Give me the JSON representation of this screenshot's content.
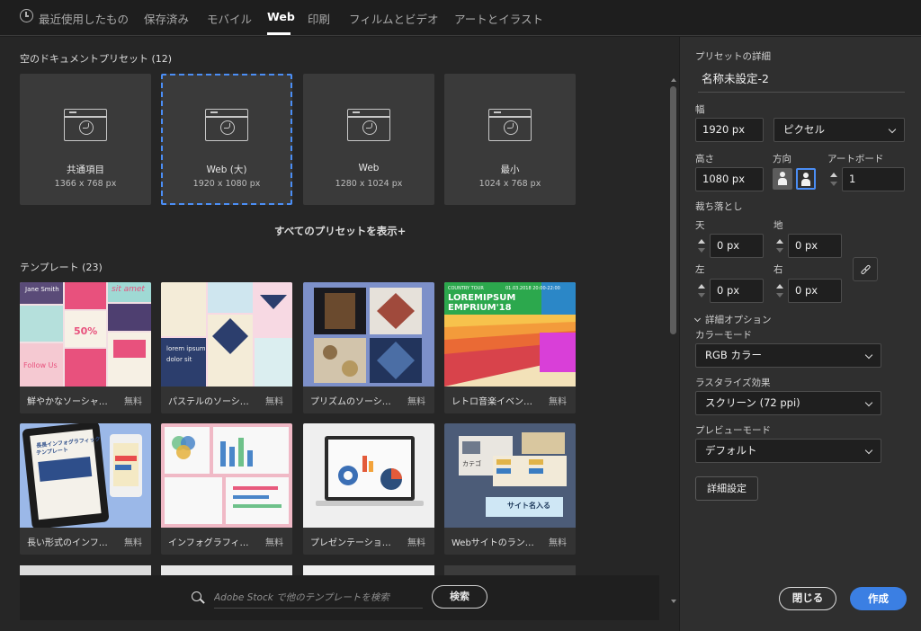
{
  "tabs": [
    {
      "label": "最近使用したもの"
    },
    {
      "label": "保存済み"
    },
    {
      "label": "モバイル"
    },
    {
      "label": "Web"
    },
    {
      "label": "印刷"
    },
    {
      "label": "フィルムとビデオ"
    },
    {
      "label": "アートとイラスト"
    }
  ],
  "active_tab": "Web",
  "presets_section": {
    "title": "空のドキュメントプリセット",
    "count": "(12)",
    "items": [
      {
        "name": "共通項目",
        "size": "1366 x 768 px",
        "icon": "browser-globe-icon"
      },
      {
        "name": "Web (大)",
        "size": "1920 x 1080 px",
        "icon": "browser-globe-icon"
      },
      {
        "name": "Web",
        "size": "1280 x 1024 px",
        "icon": "browser-globe-icon"
      },
      {
        "name": "最小",
        "size": "1024 x 768 px",
        "icon": "browser-globe-icon"
      }
    ],
    "selected_index": 1,
    "show_all": "すべてのプリセットを表示+"
  },
  "templates_section": {
    "title": "テンプレート",
    "count": "(23)",
    "items": [
      {
        "caption": "鮮やかなソーシャ…",
        "price": "無料"
      },
      {
        "caption": "パステルのソーシ…",
        "price": "無料"
      },
      {
        "caption": "プリズムのソーシ…",
        "price": "無料"
      },
      {
        "caption": "レトロ音楽イベン…",
        "price": "無料"
      },
      {
        "caption": "長い形式のインフ…",
        "price": "無料"
      },
      {
        "caption": "インフォグラフィ…",
        "price": "無料"
      },
      {
        "caption": "プレゼンテーショ…",
        "price": "無料"
      },
      {
        "caption": "Webサイトのラン…",
        "price": "無料"
      }
    ],
    "thumb_texts": {
      "t1_a": "Jane Smith",
      "t1_b": "sit amet",
      "t1_c": "50%",
      "t1_d": "Follow Us",
      "t2_a": "lorem ipsum",
      "t2_b": "dolor sit",
      "t4_a": "LOREMIPSUM",
      "t4_b": "EMPRIUM'18",
      "t4_c": "COUNTRY TOUR",
      "t4_d": "01.03.2018 20:00-22:00",
      "t5_a": "長長インフォグラフィック",
      "t5_b": "テンプレート",
      "t8_a": "カテゴ",
      "t8_b": "サイト名入る"
    }
  },
  "search": {
    "placeholder": "Adobe Stock で他のテンプレートを検索",
    "button": "検索"
  },
  "details": {
    "header": "プリセットの詳細",
    "doc_name": "名称未設定-2",
    "width_label": "幅",
    "width_value": "1920 px",
    "unit": "ピクセル",
    "height_label": "高さ",
    "height_value": "1080 px",
    "orientation_label": "方向",
    "artboard_label": "アートボード",
    "artboard_value": "1",
    "bleed_label": "裁ち落とし",
    "bleed_top_label": "天",
    "bleed_top": "0 px",
    "bleed_bottom_label": "地",
    "bleed_bottom": "0 px",
    "bleed_left_label": "左",
    "bleed_left": "0 px",
    "bleed_right_label": "右",
    "bleed_right": "0 px",
    "advanced_label": "詳細オプション",
    "color_mode_label": "カラーモード",
    "color_mode": "RGB カラー",
    "raster_label": "ラスタライズ効果",
    "raster": "スクリーン (72 ppi)",
    "preview_label": "プレビューモード",
    "preview": "デフォルト",
    "more_settings": "詳細設定",
    "close": "閉じる",
    "create": "作成"
  },
  "colors": {
    "accent": "#3b7fe3",
    "selection": "#4b8ef5",
    "panel": "#2f2f2f",
    "background": "#262626"
  }
}
